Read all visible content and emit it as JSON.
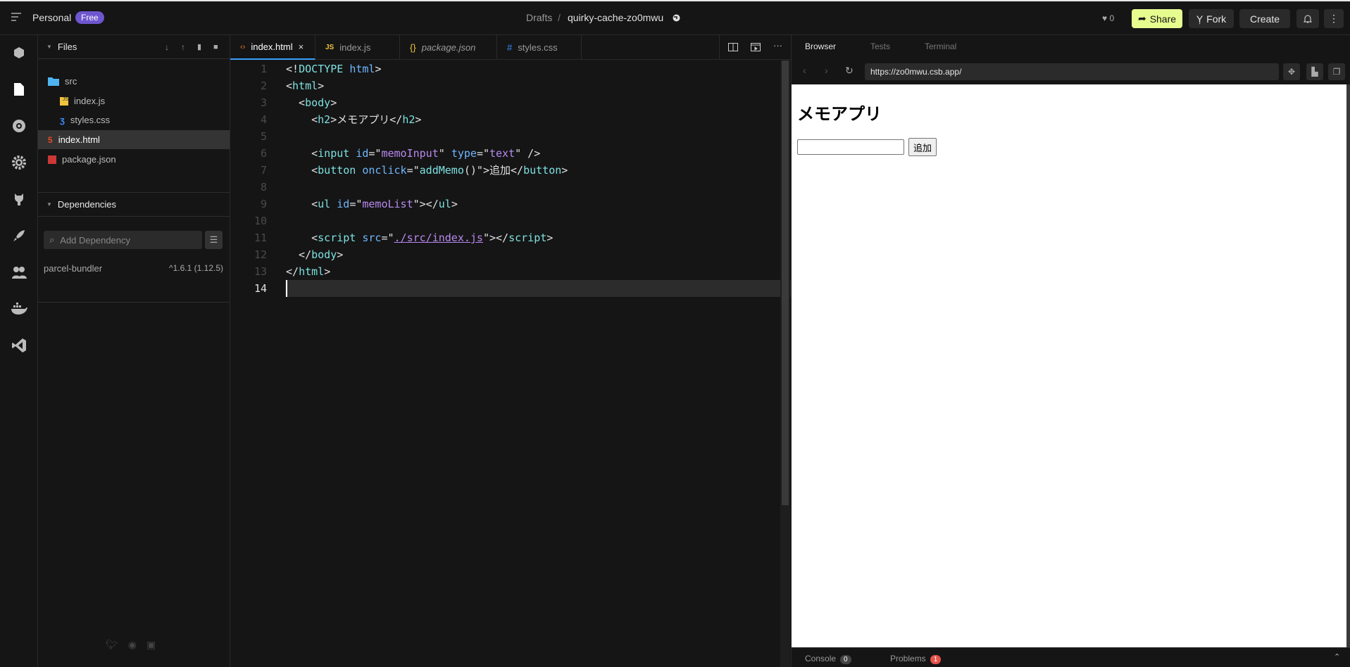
{
  "topbar": {
    "workspace": "Personal",
    "plan_badge": "Free",
    "breadcrumb_parent": "Drafts",
    "breadcrumb_sep": "/",
    "sandbox_name": "quirky-cache-zo0mwu",
    "likes": "0",
    "share_label": "Share",
    "fork_label": "Fork",
    "create_label": "Create"
  },
  "files": {
    "title": "Files",
    "items": [
      {
        "name": "src"
      },
      {
        "name": "index.js"
      },
      {
        "name": "styles.css"
      },
      {
        "name": "index.html"
      },
      {
        "name": "package.json"
      }
    ]
  },
  "dependencies": {
    "title": "Dependencies",
    "search_placeholder": "Add Dependency",
    "items": [
      {
        "name": "parcel-bundler",
        "version": "^1.6.1 (1.12.5)"
      }
    ]
  },
  "editor": {
    "tabs": [
      {
        "label": "index.html"
      },
      {
        "label": "index.js"
      },
      {
        "label": "package.json"
      },
      {
        "label": "styles.css"
      }
    ],
    "line_numbers": [
      "1",
      "2",
      "3",
      "4",
      "5",
      "6",
      "7",
      "8",
      "9",
      "10",
      "11",
      "12",
      "13",
      "14"
    ]
  },
  "right": {
    "tabs": [
      "Browser",
      "Tests",
      "Terminal"
    ],
    "url": "https://zo0mwu.csb.app/",
    "preview": {
      "heading": "メモアプリ",
      "input_value": "",
      "button_label": "追加"
    },
    "console_label": "Console",
    "console_count": "0",
    "problems_label": "Problems",
    "problems_count": "1"
  },
  "colors": {
    "accent": "#6e56cf",
    "share": "#e7fc8f",
    "active_tab": "#3aa0ff",
    "error": "#e5534b"
  }
}
